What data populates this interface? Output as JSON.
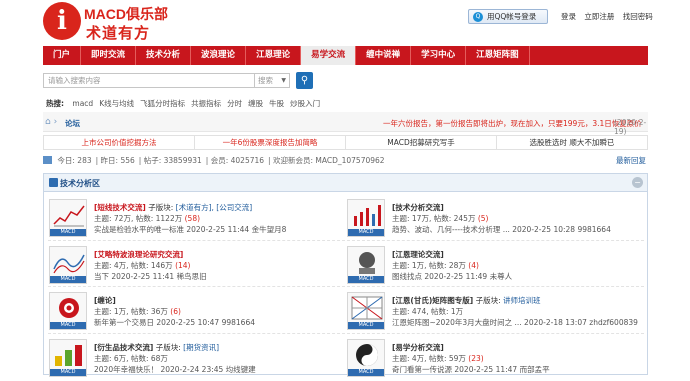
{
  "header": {
    "logo_letter": "i",
    "logo_name": "MACD俱乐部",
    "logo_slogan": "术道有方",
    "qq_login": "用QQ帐号登录",
    "login": "登录",
    "register": "立即注册",
    "forgot": "找回密码"
  },
  "nav": [
    "门户",
    "即时交流",
    "技术分析",
    "波浪理论",
    "江恩理论",
    "易学交流",
    "缠中说禅",
    "学习中心",
    "江恩矩阵图"
  ],
  "nav_active_index": 5,
  "search": {
    "placeholder": "请输入搜索内容",
    "type": "搜索"
  },
  "hot": {
    "label": "热搜:",
    "items": [
      "macd",
      "K线与均线",
      "飞狐分时指标",
      "共振指标",
      "分时",
      "缠股",
      "牛股",
      "炒股入门"
    ]
  },
  "crumb": {
    "link": "论坛",
    "notice": "一年六份报告，第一份报告即将出炉，现在加入，只要199元，3.1日恢复原价",
    "date": "(2020-2-19)"
  },
  "ads": [
    "上市公司价值挖掘方法",
    "一年6份股票深度报告加简略",
    "MACD招募研究写手",
    "选股胜选时 顺大不加瞬已"
  ],
  "stats": {
    "today": "今日: 283",
    "yesterday": "昨日: 556",
    "posts": "帖子: 33859931",
    "members": "会员: 4025716",
    "newest": "欢迎新会员: MACD_107570962",
    "latest": "最新回复"
  },
  "section": {
    "title": "技术分析区",
    "collapse": "−"
  },
  "forums": [
    {
      "name": "[短线技术交流]",
      "sub_label": " 子版块: ",
      "subs": "[术道有方], [公司交流]",
      "meta": "主题: 72万, 帖数: 1122万",
      "new": " (58)",
      "last": "实战是检验水平的唯一标准 2020-2-25 11:44 金牛望月8",
      "red": true
    },
    {
      "name": "[技术分析交流]",
      "sub_label": "",
      "subs": "",
      "meta": "主题: 17万, 帖数: 245万",
      "new": " (5)",
      "last": "趋势、波动、几何----技术分析理 ... 2020-2-25 10:28 9981664",
      "red": false
    },
    {
      "name": "[艾略特波浪理论研究交流]",
      "sub_label": "",
      "subs": "",
      "meta": "主题: 4万, 帖数: 146万",
      "new": " (14)",
      "last": "当下 2020-2-25 11:41 稀鸟思旧",
      "red": true
    },
    {
      "name": "[江恩理论交流]",
      "sub_label": "",
      "subs": "",
      "meta": "主题: 1万, 帖数: 28万",
      "new": " (4)",
      "last": "图线找点 2020-2-25 11:49 未尊人",
      "red": false
    },
    {
      "name": "[缠论]",
      "sub_label": "",
      "subs": "",
      "meta": "主题: 1万, 帖数: 36万",
      "new": " (6)",
      "last": "新年第一个交易日 2020-2-25 10:47 9981664",
      "red": false
    },
    {
      "name": "[江恩(甘氏)矩阵图专版]",
      "sub_label": " 子版块: ",
      "subs": "讲师培训班",
      "meta": "主题: 474, 帖数: 1万",
      "new": "",
      "last": "江恩矩阵图~2020年3月大盘时间之 ... 2020-2-18 13:07 zhdzf600839",
      "red": false
    },
    {
      "name": "[衍生品技术交流]",
      "sub_label": " 子版块: ",
      "subs": "[期货资讯]",
      "meta": "主题: 6万, 帖数: 68万",
      "new": "",
      "last": "2020年幸福快乐！ 2020-2-24 23:45 均线键建",
      "red": false
    },
    {
      "name": "[易学分析交流]",
      "sub_label": "",
      "subs": "",
      "meta": "主题: 4万, 帖数: 59万",
      "new": " (23)",
      "last": "奇门看第一传说源 2020-2-25 11:47 而部孟平",
      "red": false
    }
  ],
  "macd_tag": "MACD",
  "colors": {
    "brand_red": "#c8161d",
    "link_blue": "#1f5b9b",
    "nav_active_bg": "#ececec"
  }
}
